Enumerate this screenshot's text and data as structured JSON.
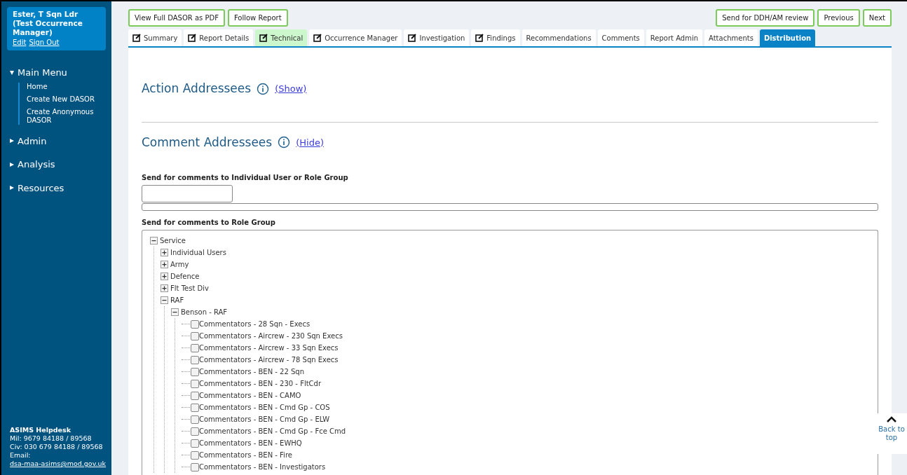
{
  "user": {
    "name": "Ester, T Sqn Ldr (Test Occurrence Manager)",
    "links": [
      "Edit",
      "Sign Out"
    ]
  },
  "menu": [
    {
      "label": "Main Menu",
      "expanded": true,
      "items": [
        "Home",
        "Create New DASOR",
        "Create Anonymous DASOR"
      ]
    },
    {
      "label": "Admin",
      "expanded": false
    },
    {
      "label": "Analysis",
      "expanded": false
    },
    {
      "label": "Resources",
      "expanded": false
    }
  ],
  "helpdesk": {
    "title": "ASIMS Helpdesk",
    "lines": [
      "Mil: 9679 84188 / 89568",
      "Civ: 030 679 84188 / 89568"
    ],
    "email_label": "Email:",
    "email": "dsa-maa-asims@mod.gov.uk"
  },
  "toolbar_left": [
    "View Full DASOR as PDF",
    "Follow Report"
  ],
  "toolbar_right": [
    "Send for DDH/AM review",
    "Previous",
    "Next"
  ],
  "tabs": [
    {
      "label": "Summary",
      "kind": "editable",
      "highlighted": false,
      "selected": false
    },
    {
      "label": "Report Details",
      "kind": "editable",
      "highlighted": false,
      "selected": false
    },
    {
      "label": "Technical",
      "kind": "editable",
      "highlighted": true,
      "selected": false
    },
    {
      "label": "Occurrence Manager",
      "kind": "editable",
      "highlighted": false,
      "selected": false
    },
    {
      "label": "Investigation",
      "kind": "editable",
      "highlighted": false,
      "selected": false
    },
    {
      "label": "Findings",
      "kind": "editable",
      "highlighted": false,
      "selected": false
    },
    {
      "label": "Recommendations",
      "kind": "plain",
      "highlighted": false,
      "selected": false
    },
    {
      "label": "Comments",
      "kind": "plain",
      "highlighted": false,
      "selected": false
    },
    {
      "label": "Report Admin",
      "kind": "plain",
      "highlighted": false,
      "selected": false
    },
    {
      "label": "Attachments",
      "kind": "plain",
      "highlighted": false,
      "selected": false
    },
    {
      "label": "Distribution",
      "kind": "plain",
      "highlighted": false,
      "selected": true
    }
  ],
  "sections": [
    {
      "title": "Action Addressees",
      "toggle": "(Show)"
    },
    {
      "title": "Comment Addressees",
      "toggle": "(Hide)"
    }
  ],
  "individual_label": "Send for comments to Individual User or Role Group",
  "role_group_label": "Send for comments to Role Group",
  "tree": [
    {
      "label": "Service",
      "expanded": true,
      "children": [
        {
          "label": "Individual Users",
          "expanded": false
        },
        {
          "label": "Army",
          "expanded": false
        },
        {
          "label": "Defence",
          "expanded": false
        },
        {
          "label": "Flt Test Div",
          "expanded": false
        },
        {
          "label": "RAF",
          "expanded": true,
          "children": [
            {
              "label": "Benson - RAF",
              "expanded": true,
              "children": [
                {
                  "label": "Commentators - 28 Sqn - Execs",
                  "checked": false
                },
                {
                  "label": "Commentators - Aircrew - 230 Sqn Execs",
                  "checked": false
                },
                {
                  "label": "Commentators - Aircrew - 33 Sqn Execs",
                  "checked": false
                },
                {
                  "label": "Commentators - Aircrew - 78 Sqn Execs",
                  "checked": false
                },
                {
                  "label": "Commentators - BEN - 22 Sqn",
                  "checked": false
                },
                {
                  "label": "Commentators - BEN - 230 - FltCdr",
                  "checked": false
                },
                {
                  "label": "Commentators - BEN - CAMO",
                  "checked": false
                },
                {
                  "label": "Commentators - BEN - Cmd Gp - COS",
                  "checked": false
                },
                {
                  "label": "Commentators - BEN - Cmd Gp - ELW",
                  "checked": false
                },
                {
                  "label": "Commentators - BEN - Cmd Gp - Fce Cmd",
                  "checked": false
                },
                {
                  "label": "Commentators - BEN - EWHQ",
                  "checked": false
                },
                {
                  "label": "Commentators - BEN - Fire",
                  "checked": false
                },
                {
                  "label": "Commentators - BEN - Investigators",
                  "checked": false
                }
              ]
            }
          ]
        }
      ]
    }
  ],
  "back_to_top": "Back to top"
}
